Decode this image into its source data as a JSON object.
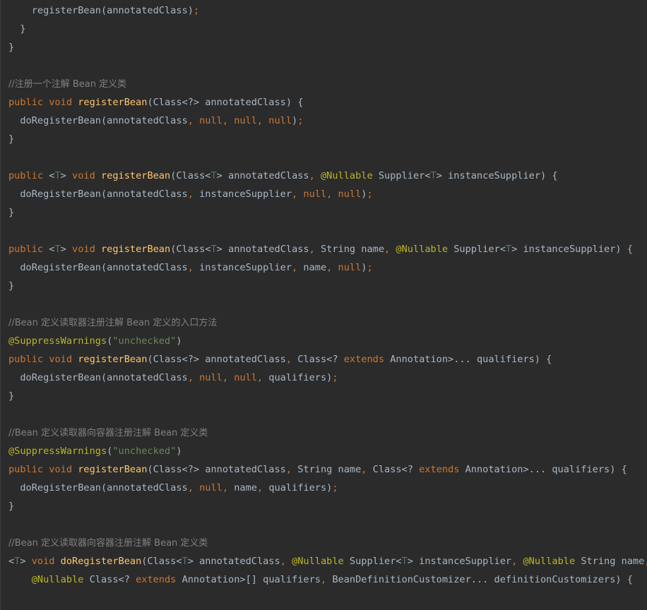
{
  "editor": {
    "background": "#2b2b2b",
    "colors": {
      "plain": "#a9b7c6",
      "keyword": "#cc7832",
      "function": "#ffc66d",
      "comment": "#808080",
      "annotation": "#bbb529",
      "string": "#6a8759",
      "type_param": "#507874"
    },
    "lines": [
      [
        [
          "plain",
          "    registerBean(annotatedClass)"
        ],
        [
          "kw",
          ";"
        ]
      ],
      [
        [
          "plain",
          "  }"
        ]
      ],
      [
        [
          "plain",
          "}"
        ]
      ],
      [],
      [
        [
          "cm",
          "//注册一个注解 Bean 定义类"
        ]
      ],
      [
        [
          "kw",
          "public void "
        ],
        [
          "fn",
          "registerBean"
        ],
        [
          "plain",
          "(Class<?> annotatedClass) {"
        ]
      ],
      [
        [
          "plain",
          "  doRegisterBean(annotatedClass"
        ],
        [
          "kw",
          ", null, null, null"
        ],
        [
          "plain",
          ")"
        ],
        [
          "kw",
          ";"
        ]
      ],
      [
        [
          "plain",
          "}"
        ]
      ],
      [],
      [
        [
          "kw",
          "public "
        ],
        [
          "plain",
          "<"
        ],
        [
          "tp",
          "T"
        ],
        [
          "plain",
          "> "
        ],
        [
          "kw",
          "void "
        ],
        [
          "fn",
          "registerBean"
        ],
        [
          "plain",
          "(Class<"
        ],
        [
          "tp",
          "T"
        ],
        [
          "plain",
          "> annotatedClass"
        ],
        [
          "kw",
          ", "
        ],
        [
          "an",
          "@Nullable "
        ],
        [
          "plain",
          "Supplier<"
        ],
        [
          "tp",
          "T"
        ],
        [
          "plain",
          "> instanceSupplier) {"
        ]
      ],
      [
        [
          "plain",
          "  doRegisterBean(annotatedClass"
        ],
        [
          "kw",
          ", "
        ],
        [
          "plain",
          "instanceSupplier"
        ],
        [
          "kw",
          ", null, null"
        ],
        [
          "plain",
          ")"
        ],
        [
          "kw",
          ";"
        ]
      ],
      [
        [
          "plain",
          "}"
        ]
      ],
      [],
      [
        [
          "kw",
          "public "
        ],
        [
          "plain",
          "<"
        ],
        [
          "tp",
          "T"
        ],
        [
          "plain",
          "> "
        ],
        [
          "kw",
          "void "
        ],
        [
          "fn",
          "registerBean"
        ],
        [
          "plain",
          "(Class<"
        ],
        [
          "tp",
          "T"
        ],
        [
          "plain",
          "> annotatedClass"
        ],
        [
          "kw",
          ", "
        ],
        [
          "plain",
          "String name"
        ],
        [
          "kw",
          ", "
        ],
        [
          "an",
          "@Nullable "
        ],
        [
          "plain",
          "Supplier<"
        ],
        [
          "tp",
          "T"
        ],
        [
          "plain",
          "> instanceSupplier) {"
        ]
      ],
      [
        [
          "plain",
          "  doRegisterBean(annotatedClass"
        ],
        [
          "kw",
          ", "
        ],
        [
          "plain",
          "instanceSupplier"
        ],
        [
          "kw",
          ", "
        ],
        [
          "plain",
          "name"
        ],
        [
          "kw",
          ", null"
        ],
        [
          "plain",
          ")"
        ],
        [
          "kw",
          ";"
        ]
      ],
      [
        [
          "plain",
          "}"
        ]
      ],
      [],
      [
        [
          "cm",
          "//Bean 定义读取器注册注解 Bean 定义的入口方法"
        ]
      ],
      [
        [
          "an",
          "@SuppressWarnings"
        ],
        [
          "plain",
          "("
        ],
        [
          "str",
          "\"unchecked\""
        ],
        [
          "plain",
          ")"
        ]
      ],
      [
        [
          "kw",
          "public void "
        ],
        [
          "fn",
          "registerBean"
        ],
        [
          "plain",
          "(Class<?> annotatedClass"
        ],
        [
          "kw",
          ", "
        ],
        [
          "plain",
          "Class<? "
        ],
        [
          "kw",
          "extends "
        ],
        [
          "plain",
          "Annotation>... qualifiers) {"
        ]
      ],
      [
        [
          "plain",
          "  doRegisterBean(annotatedClass"
        ],
        [
          "kw",
          ", null, null, "
        ],
        [
          "plain",
          "qualifiers)"
        ],
        [
          "kw",
          ";"
        ]
      ],
      [
        [
          "plain",
          "}"
        ]
      ],
      [],
      [
        [
          "cm",
          "//Bean 定义读取器向容器注册注解 Bean 定义类"
        ]
      ],
      [
        [
          "an",
          "@SuppressWarnings"
        ],
        [
          "plain",
          "("
        ],
        [
          "str",
          "\"unchecked\""
        ],
        [
          "plain",
          ")"
        ]
      ],
      [
        [
          "kw",
          "public void "
        ],
        [
          "fn",
          "registerBean"
        ],
        [
          "plain",
          "(Class<?> annotatedClass"
        ],
        [
          "kw",
          ", "
        ],
        [
          "plain",
          "String name"
        ],
        [
          "kw",
          ", "
        ],
        [
          "plain",
          "Class<? "
        ],
        [
          "kw",
          "extends "
        ],
        [
          "plain",
          "Annotation>... qualifiers) {"
        ]
      ],
      [
        [
          "plain",
          "  doRegisterBean(annotatedClass"
        ],
        [
          "kw",
          ", null, "
        ],
        [
          "plain",
          "name"
        ],
        [
          "kw",
          ", "
        ],
        [
          "plain",
          "qualifiers)"
        ],
        [
          "kw",
          ";"
        ]
      ],
      [
        [
          "plain",
          "}"
        ]
      ],
      [],
      [
        [
          "cm",
          "//Bean 定义读取器向容器注册注解 Bean 定义类"
        ]
      ],
      [
        [
          "plain",
          "<"
        ],
        [
          "tp",
          "T"
        ],
        [
          "plain",
          "> "
        ],
        [
          "kw",
          "void "
        ],
        [
          "fn",
          "doRegisterBean"
        ],
        [
          "plain",
          "(Class<"
        ],
        [
          "tp",
          "T"
        ],
        [
          "plain",
          "> annotatedClass"
        ],
        [
          "kw",
          ", "
        ],
        [
          "an",
          "@Nullable "
        ],
        [
          "plain",
          "Supplier<"
        ],
        [
          "tp",
          "T"
        ],
        [
          "plain",
          "> instanceSupplier"
        ],
        [
          "kw",
          ", "
        ],
        [
          "an",
          "@Nullable "
        ],
        [
          "plain",
          "String name"
        ],
        [
          "kw",
          ","
        ]
      ],
      [
        [
          "plain",
          "    "
        ],
        [
          "an",
          "@Nullable "
        ],
        [
          "plain",
          "Class<? "
        ],
        [
          "kw",
          "extends "
        ],
        [
          "plain",
          "Annotation>[] qualifiers"
        ],
        [
          "kw",
          ", "
        ],
        [
          "plain",
          "BeanDefinitionCustomizer... definitionCustomizers) {"
        ]
      ]
    ]
  }
}
